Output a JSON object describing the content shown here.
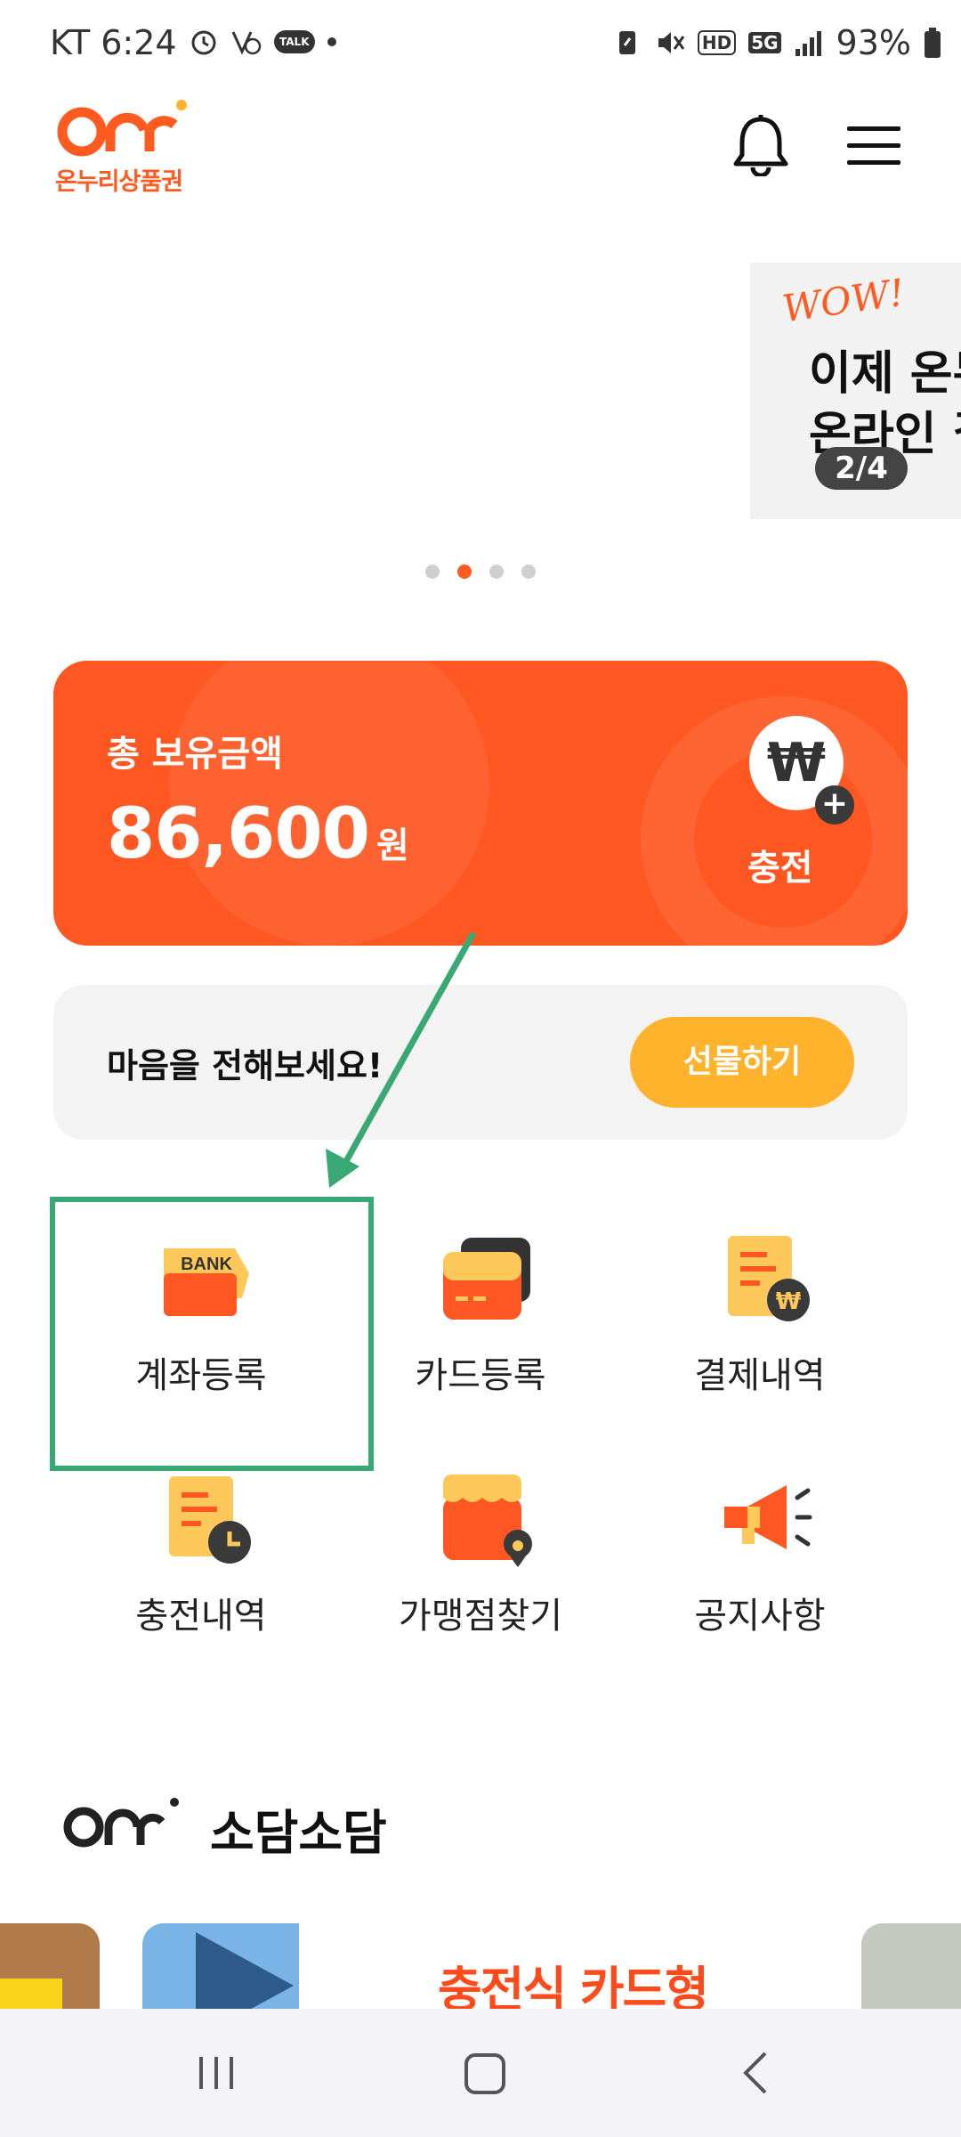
{
  "status_bar": {
    "carrier_time": "KT 6:24",
    "battery": "93%",
    "talk_badge": "TALK",
    "hd_badge": "HD",
    "network_badge": "5G"
  },
  "header": {
    "logo_text": "온누리상품권"
  },
  "banner": {
    "wow": "WOW!",
    "line1": "이제 온누",
    "line2": "온라인 결",
    "counter": "2/4",
    "pages": 4,
    "active_page": 2
  },
  "balance": {
    "label": "총 보유금액",
    "amount": "86,600",
    "unit": "원",
    "charge_symbol": "₩",
    "charge_label": "충전"
  },
  "gift": {
    "text": "마음을 전해보세요!",
    "button": "선물하기"
  },
  "menu_grid": [
    {
      "label": "계좌등록",
      "icon": "bank-icon",
      "icon_text": "BANK"
    },
    {
      "label": "카드등록",
      "icon": "card-icon"
    },
    {
      "label": "결제내역",
      "icon": "payment-history-icon"
    },
    {
      "label": "충전내역",
      "icon": "charge-history-icon"
    },
    {
      "label": "가맹점찾기",
      "icon": "store-locator-icon"
    },
    {
      "label": "공지사항",
      "icon": "megaphone-icon"
    }
  ],
  "sodam": {
    "title": "소담소담"
  },
  "carousel": {
    "text": "충전식 카드형"
  },
  "colors": {
    "brand": "#ff5722",
    "gift_button": "#ffb22c",
    "highlight": "#3aa874"
  }
}
